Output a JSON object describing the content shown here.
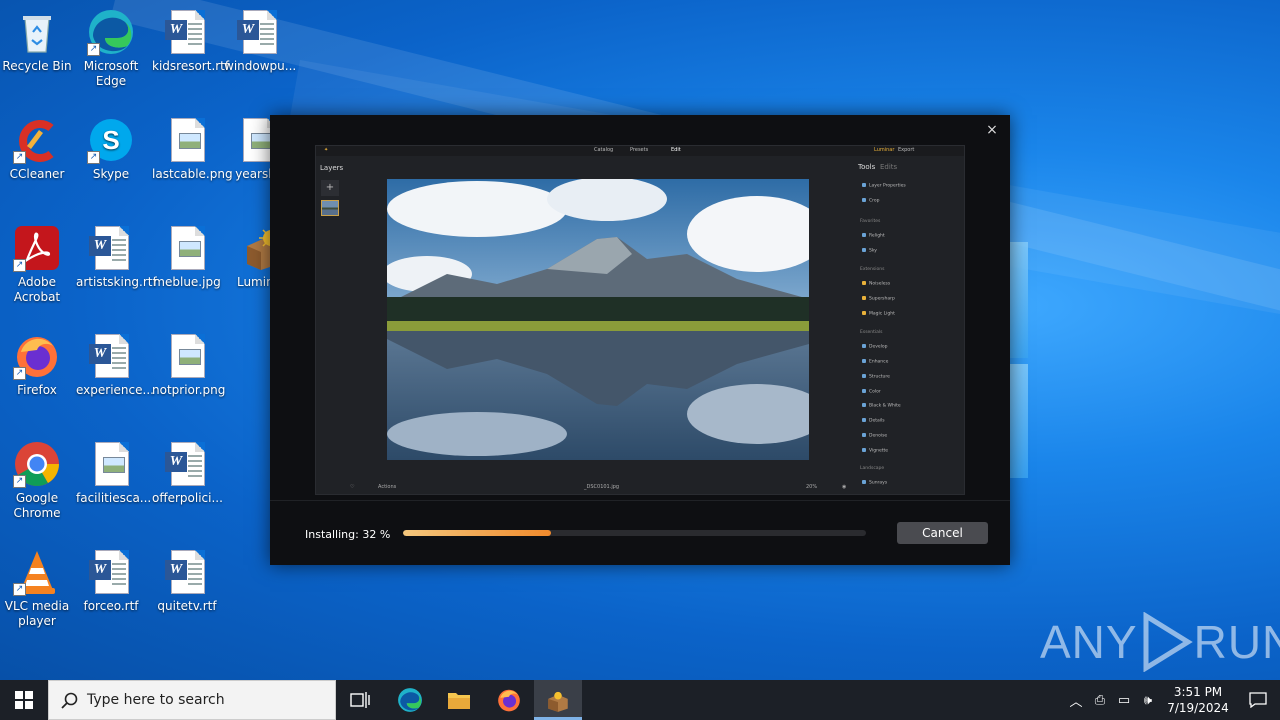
{
  "desktop": {
    "icons": [
      {
        "label": "Recycle Bin",
        "icon": "recycle-bin-icon"
      },
      {
        "label": "Microsoft Edge",
        "icon": "edge-icon"
      },
      {
        "label": "kidsresort.rtf",
        "icon": "word-document-icon"
      },
      {
        "label": "windowpu...",
        "icon": "word-document-icon"
      },
      {
        "label": "CCleaner",
        "icon": "ccleaner-icon"
      },
      {
        "label": "Skype",
        "icon": "skype-icon"
      },
      {
        "label": "lastcable.png",
        "icon": "image-file-icon"
      },
      {
        "label": "yearskb",
        "icon": "image-file-icon"
      },
      {
        "label": "Adobe Acrobat",
        "icon": "acrobat-icon"
      },
      {
        "label": "artistsking.rtf",
        "icon": "word-document-icon"
      },
      {
        "label": "meblue.jpg",
        "icon": "image-file-icon"
      },
      {
        "label": "Lumina",
        "icon": "luminar-installer-icon"
      },
      {
        "label": "Firefox",
        "icon": "firefox-icon"
      },
      {
        "label": "experience...",
        "icon": "word-document-icon"
      },
      {
        "label": "notprior.png",
        "icon": "image-file-icon"
      },
      {
        "label": "Google Chrome",
        "icon": "chrome-icon"
      },
      {
        "label": "facilitiesca...",
        "icon": "image-file-icon"
      },
      {
        "label": "offerpolici...",
        "icon": "word-document-icon"
      },
      {
        "label": "VLC media player",
        "icon": "vlc-icon"
      },
      {
        "label": "forceo.rtf",
        "icon": "word-document-icon"
      },
      {
        "label": "quitetv.rtf",
        "icon": "word-document-icon"
      }
    ]
  },
  "installer": {
    "close_glyph": "×",
    "progress_label": "Installing: 32 %",
    "progress_fraction": 0.32,
    "cancel_label": "Cancel",
    "preview": {
      "top_tabs": [
        "Catalog",
        "Presets",
        "Edit"
      ],
      "top_right": [
        "Luminar",
        "Export"
      ],
      "layers_title": "Layers",
      "tools_title": "Tools",
      "edits_title": "Edits",
      "bottom_filename": "_DSC0101.jpg",
      "bottom_left": "Actions",
      "bottom_zoom": "20%",
      "tool_sections": [
        {
          "heading": "",
          "items": [
            "Layer Properties",
            "Crop"
          ]
        },
        {
          "heading": "Favorites",
          "items": [
            "Relight",
            "Sky"
          ]
        },
        {
          "heading": "Extensions",
          "items": [
            "Noiseless",
            "Supersharp",
            "Magic Light"
          ]
        },
        {
          "heading": "Essentials",
          "items": [
            "Develop",
            "Enhance",
            "Structure",
            "Color",
            "Black & White",
            "Details",
            "Denoise",
            "Vignette"
          ]
        },
        {
          "heading": "Landscape",
          "items": [
            "Sunrays"
          ]
        }
      ]
    }
  },
  "watermark": {
    "text_left": "ANY",
    "text_right": "RUN"
  },
  "taskbar": {
    "search_placeholder": "Type here to search",
    "clock_time": "3:51 PM",
    "clock_date": "7/19/2024"
  }
}
